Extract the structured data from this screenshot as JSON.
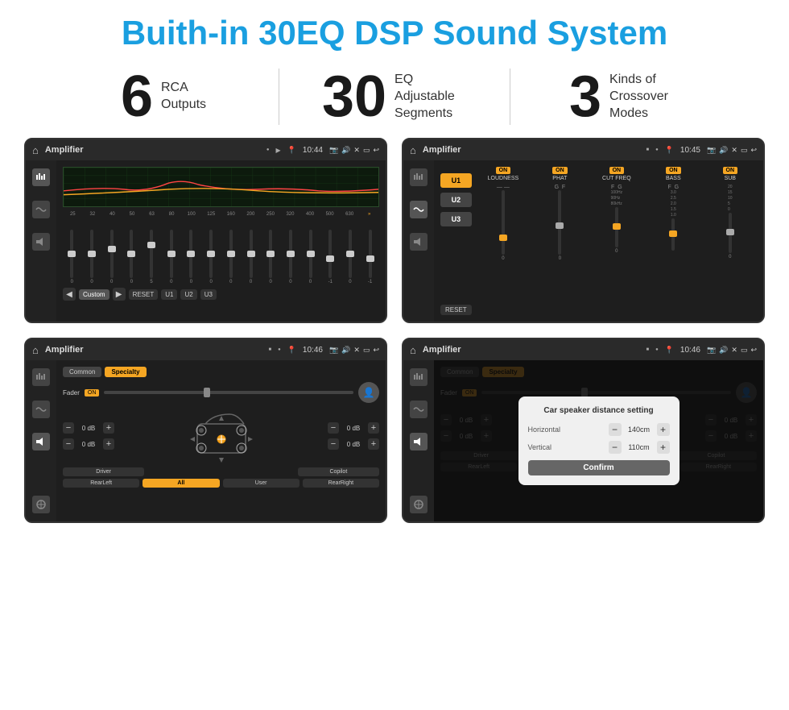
{
  "title": "Buith-in 30EQ DSP Sound System",
  "stats": [
    {
      "number": "6",
      "label": "RCA\nOutputs"
    },
    {
      "number": "30",
      "label": "EQ Adjustable\nSegments"
    },
    {
      "number": "3",
      "label": "Kinds of\nCrossover Modes"
    }
  ],
  "screens": [
    {
      "id": "screen1",
      "topbar": {
        "title": "Amplifier",
        "time": "10:44"
      },
      "type": "eq",
      "freqs": [
        "25",
        "32",
        "40",
        "50",
        "63",
        "80",
        "100",
        "125",
        "160",
        "200",
        "250",
        "320",
        "400",
        "500",
        "630"
      ],
      "values": [
        "0",
        "0",
        "0",
        "0",
        "5",
        "0",
        "0",
        "0",
        "0",
        "0",
        "0",
        "0",
        "0",
        "-1",
        "0",
        "-1"
      ],
      "buttons": [
        "Custom",
        "RESET",
        "U1",
        "U2",
        "U3"
      ]
    },
    {
      "id": "screen2",
      "topbar": {
        "title": "Amplifier",
        "time": "10:45"
      },
      "type": "amplifier2",
      "uButtons": [
        "U1",
        "U2",
        "U3"
      ],
      "controls": [
        {
          "label": "LOUDNESS",
          "on": true,
          "thumbPos": 60
        },
        {
          "label": "PHAT",
          "on": true,
          "thumbPos": 40
        },
        {
          "label": "CUT FREQ",
          "on": true,
          "thumbPos": 30
        },
        {
          "label": "BASS",
          "on": true,
          "thumbPos": 50
        },
        {
          "label": "SUB",
          "on": true,
          "thumbPos": 45
        }
      ],
      "resetLabel": "RESET"
    },
    {
      "id": "screen3",
      "topbar": {
        "title": "Amplifier",
        "time": "10:46"
      },
      "type": "speaker",
      "tabs": [
        "Common",
        "Specialty"
      ],
      "activeTab": "Specialty",
      "faderLabel": "Fader",
      "faderOn": "ON",
      "leftDbValues": [
        "0 dB",
        "0 dB"
      ],
      "rightDbValues": [
        "0 dB",
        "0 dB"
      ],
      "bottomButtons": [
        "Driver",
        "",
        "",
        "Copilot"
      ],
      "bottomRow2": [
        "RearLeft",
        "All",
        "User",
        "RearRight"
      ]
    },
    {
      "id": "screen4",
      "topbar": {
        "title": "Amplifier",
        "time": "10:46"
      },
      "type": "speaker-dialog",
      "tabs": [
        "Common",
        "Specialty"
      ],
      "activeTab": "Specialty",
      "dialog": {
        "title": "Car speaker distance setting",
        "horizontal": {
          "label": "Horizontal",
          "value": "140cm"
        },
        "vertical": {
          "label": "Vertical",
          "value": "110cm"
        },
        "confirmLabel": "Confirm"
      },
      "rightDbValues": [
        "0 dB",
        "0 dB"
      ],
      "bottomButtons": [
        "Driver",
        "",
        "",
        "Copilot"
      ],
      "bottomRow2": [
        "RearLeft",
        "All",
        "User",
        "RearRight"
      ]
    }
  ],
  "colors": {
    "accent": "#1a9fe0",
    "orange": "#f5a623",
    "darkBg": "#1e1e1e",
    "titleColor": "#1a1a1a"
  }
}
